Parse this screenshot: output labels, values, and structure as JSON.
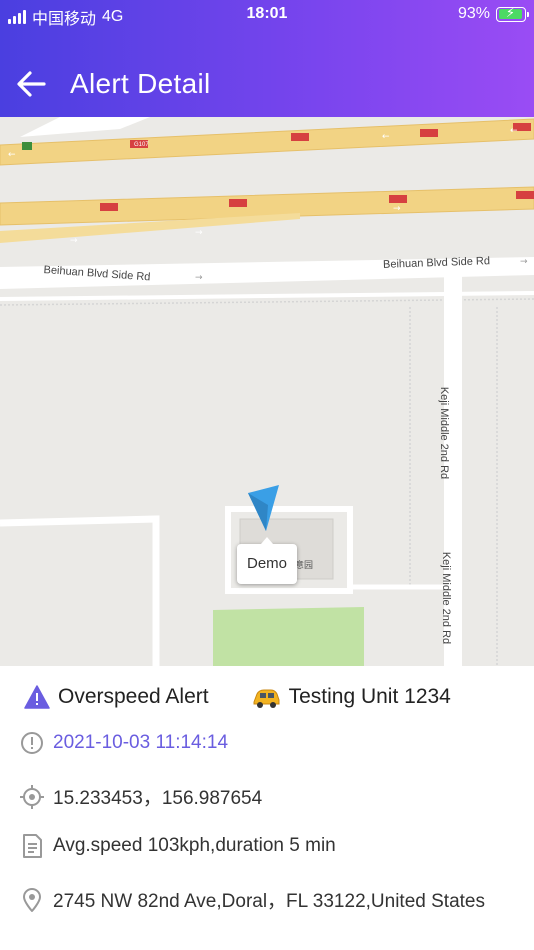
{
  "status_bar": {
    "carrier": "中国移动",
    "network": "4G",
    "time": "18:01",
    "battery_percent": "93%",
    "battery_level": 0.93
  },
  "header": {
    "title": "Alert Detail"
  },
  "map": {
    "marker_label": "Demo",
    "roads": {
      "main_road": "Beihuan Blvd Side Rd",
      "main_road_right": "Beihuan Blvd Side Rd",
      "vertical_road_1": "Keji Middle 2nd Rd",
      "vertical_road_2": "Keji Middle 2nd Rd",
      "highway_shield": "G107",
      "poi": "友利创意园"
    }
  },
  "alert": {
    "type": "Overspeed Alert",
    "unit": "Testing Unit 1234",
    "datetime": "2021-10-03 11:14:14",
    "coordinates": "15.233453，156.987654",
    "description": "Avg.speed 103kph,duration 5 min",
    "address": "2745 NW 82nd Ave,Doral，FL 33122,United States"
  },
  "colors": {
    "header_gradient_start": "#4a3fe0",
    "header_gradient_end": "#9a4cf4",
    "accent": "#6a5de0",
    "warning_icon": "#6a5de0",
    "marker": "#3a9fe6"
  }
}
